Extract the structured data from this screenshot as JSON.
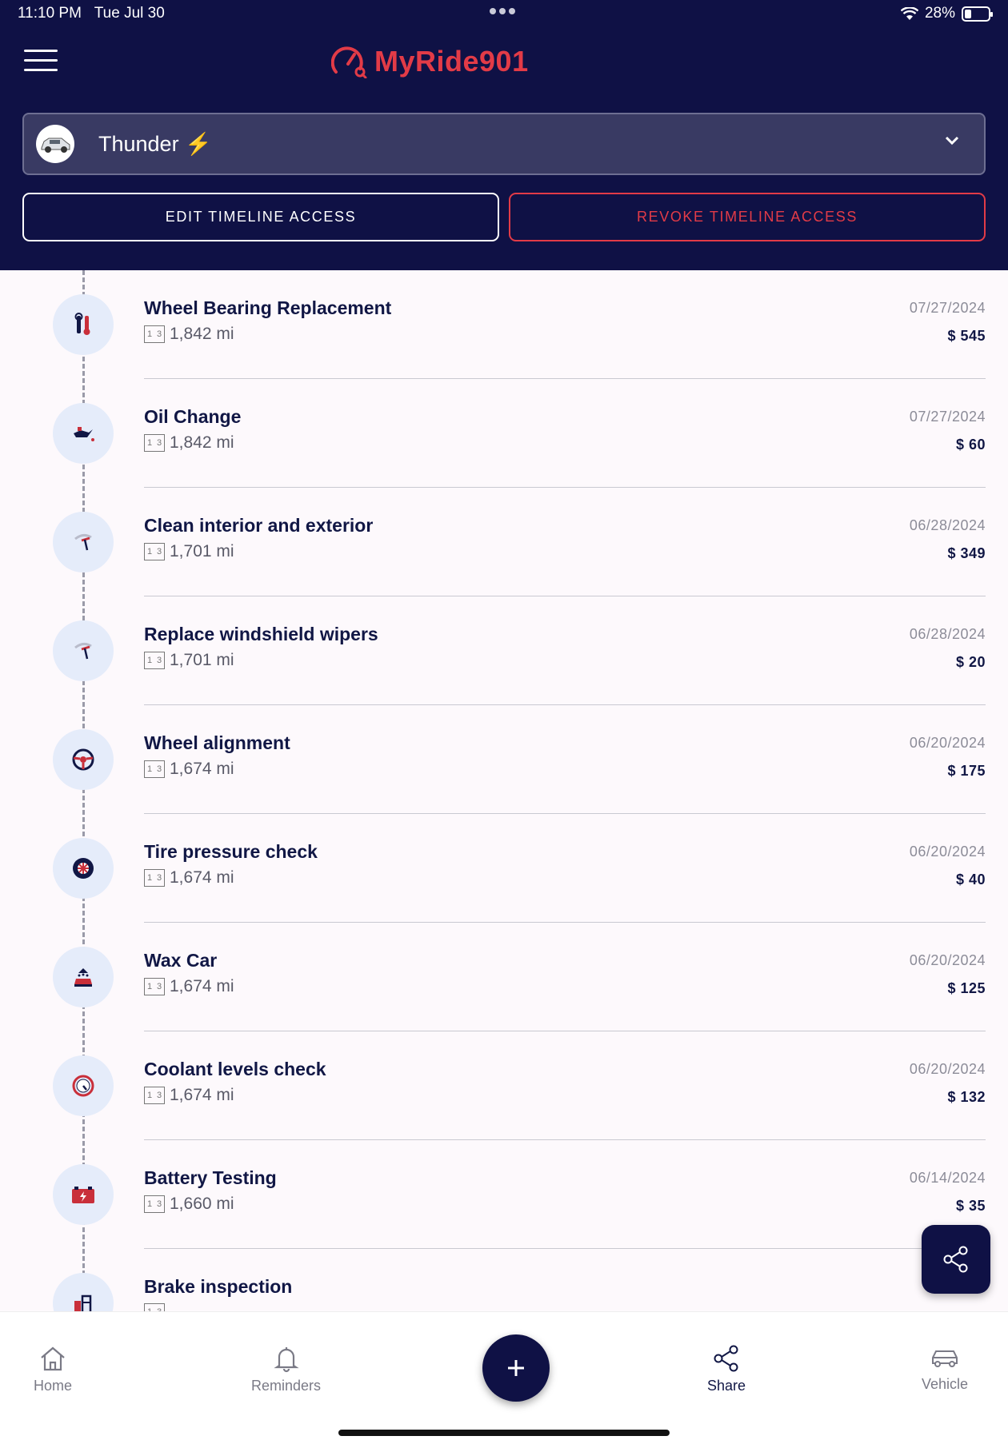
{
  "status": {
    "time": "11:10 PM",
    "date": "Tue Jul 30",
    "battery": "28%",
    "battery_level": 0.28
  },
  "app": {
    "name": "MyRide901"
  },
  "vehicle": {
    "name": "Thunder ⚡"
  },
  "actions": {
    "edit": "EDIT TIMELINE ACCESS",
    "revoke": "REVOKE TIMELINE ACCESS"
  },
  "entries": [
    {
      "title": "Wheel Bearing Replacement",
      "miles": "1,842 mi",
      "date": "07/27/2024",
      "cost": "$ 545",
      "icon": "wrench-icon"
    },
    {
      "title": "Oil Change",
      "miles": "1,842 mi",
      "date": "07/27/2024",
      "cost": "$ 60",
      "icon": "oil-can-icon"
    },
    {
      "title": "Clean interior and exterior",
      "miles": "1,701 mi",
      "date": "06/28/2024",
      "cost": "$ 349",
      "icon": "wiper-icon"
    },
    {
      "title": "Replace windshield wipers",
      "miles": "1,701 mi",
      "date": "06/28/2024",
      "cost": "$ 20",
      "icon": "wiper-icon"
    },
    {
      "title": "Wheel alignment",
      "miles": "1,674 mi",
      "date": "06/20/2024",
      "cost": "$ 175",
      "icon": "steering-wheel-icon"
    },
    {
      "title": "Tire pressure check",
      "miles": "1,674 mi",
      "date": "06/20/2024",
      "cost": "$ 40",
      "icon": "tire-icon"
    },
    {
      "title": "Wax Car",
      "miles": "1,674 mi",
      "date": "06/20/2024",
      "cost": "$ 125",
      "icon": "car-wash-icon"
    },
    {
      "title": "Coolant levels check",
      "miles": "1,674 mi",
      "date": "06/20/2024",
      "cost": "$ 132",
      "icon": "gauge-icon"
    },
    {
      "title": "Battery Testing",
      "miles": "1,660 mi",
      "date": "06/14/2024",
      "cost": "$ 35",
      "icon": "battery-icon"
    },
    {
      "title": "Brake inspection",
      "miles": "",
      "date": "",
      "cost": "",
      "icon": "brake-icon"
    }
  ],
  "nav": {
    "home": "Home",
    "reminders": "Reminders",
    "share": "Share",
    "vehicle": "Vehicle"
  },
  "colors": {
    "navy": "#0f1145",
    "accent_red": "#e23b47",
    "icon_bg": "#e5ecfa"
  }
}
